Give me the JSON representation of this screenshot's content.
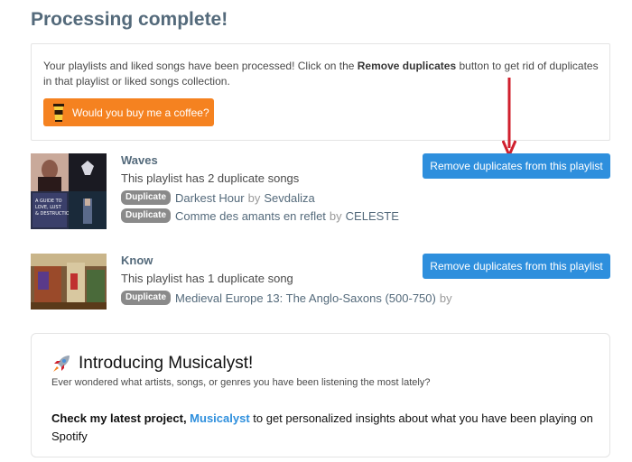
{
  "page": {
    "title": "Processing complete!"
  },
  "info": {
    "text_before": "Your playlists and liked songs have been processed! Click on the ",
    "text_bold": "Remove duplicates",
    "text_after": " button to get rid of duplicates in that playlist or liked songs collection.",
    "coffee_button": "Would you buy me a coffee?"
  },
  "playlists": [
    {
      "name": "Waves",
      "count_text": "This playlist has 2 duplicate songs",
      "button_label": "Remove duplicates from this playlist",
      "duplicates": [
        {
          "tag": "Duplicate",
          "song": "Darkest Hour",
          "by": "by",
          "artist": "Sevdaliza"
        },
        {
          "tag": "Duplicate",
          "song": "Comme des amants en reflet",
          "by": "by",
          "artist": "CELESTE"
        }
      ]
    },
    {
      "name": "Know",
      "count_text": "This playlist has 1 duplicate song",
      "button_label": "Remove duplicates from this playlist",
      "duplicates": [
        {
          "tag": "Duplicate",
          "song": "Medieval Europe 13: The Anglo-Saxons (500-750)",
          "by": "by",
          "artist": ""
        }
      ]
    }
  ],
  "cover_art": {
    "tile_text": "A GUIDE TO LOVE, LUST & DESTRUCTION"
  },
  "musicalyst": {
    "title": "Introducing Musicalyst!",
    "subtitle": "Ever wondered what artists, songs, or genres you have been listening the most lately?",
    "text_bold": "Check my latest project, ",
    "link": "Musicalyst",
    "text_after": " to get personalized insights about what you have been playing on Spotify"
  },
  "colors": {
    "accent": "#2e8fdd",
    "coffee": "#f58220",
    "title": "#546a7b",
    "arrow": "#d0202e"
  },
  "icons": {
    "coffee": "coffee-cup-icon",
    "rocket": "rocket-icon",
    "arrow": "arrow-down-icon"
  }
}
